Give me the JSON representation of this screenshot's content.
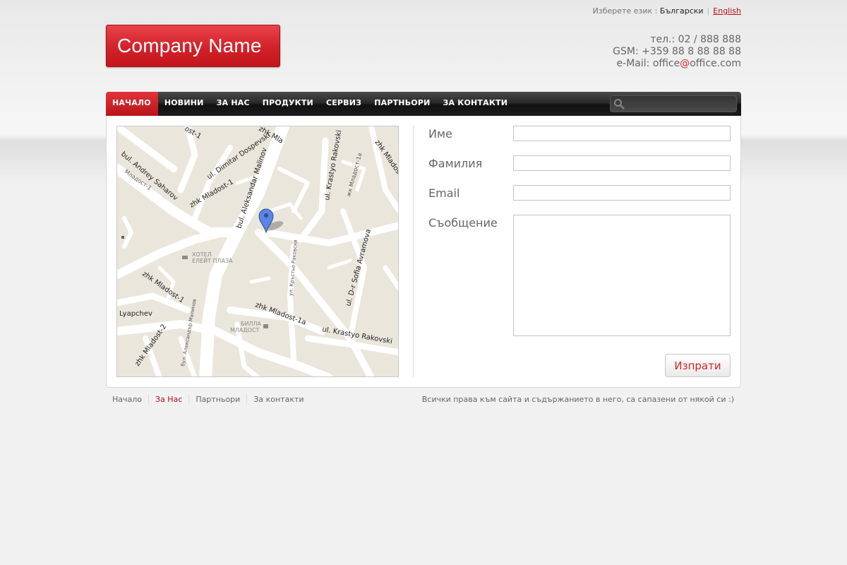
{
  "language": {
    "prompt": "Изберете език :",
    "current": "Български",
    "other": "English"
  },
  "logo": {
    "text": "Company Name"
  },
  "contacts": {
    "phone": "тел.: 02 / 888 888",
    "gsm": "GSM: +359 88 8 88 88 88",
    "email_prefix": "e-Mail: office",
    "email_at": "@",
    "email_suffix": "office.com"
  },
  "nav": {
    "items": [
      "НАЧАЛО",
      "НОВИНИ",
      "ЗА НАС",
      "ПРОДУКТИ",
      "СЕРВИЗ",
      "ПАРТНЬОРИ",
      "ЗА КОНТАКТИ"
    ],
    "active_index": 0
  },
  "map": {
    "labels": {
      "dimitar": "ul. Dimitar Dospevski",
      "sharov": "bul. Andrey Saharov",
      "mladost1a_top": "zhk Mladost-1",
      "malinov": "bul. Aleksandar Malinov",
      "rakovski": "ul. Krastyo Rakovski",
      "mladost_right": "zhk Mladost",
      "mladost1a": "жк Младост-1а",
      "hotel1": "ХОТЕЛ",
      "hotel2": "ЕЛЕЙТ ПЛАЗА",
      "rakovski_bg": "ул. Кръстьо Раковски",
      "sofia": "ul. D-r Sofia Avramova",
      "zhk_mladost1": "zhk Mladost-1",
      "zhk_mladost1a": "zhk Mladost-1a",
      "lyapchev": "Lyapchev",
      "billa1": "БИЛЛА",
      "billa2": "МЛАДОСТ",
      "rakovski2": "ul. Krastyo Rakovski",
      "mladost2": "zhk Mladost-2",
      "malinov_bg": "бул. Александър Малинов",
      "mladost1_bg": "Младост-1",
      "top_label": "ost-1",
      "top_label2": "zhk Mla"
    }
  },
  "form": {
    "first_name": "Име",
    "last_name": "Фамилия",
    "email": "Email",
    "message": "Съобщение",
    "submit": "Изпрати"
  },
  "footer": {
    "links": [
      "Начало",
      "За Нас",
      "Партньори",
      "За контакти"
    ],
    "active_index": 1,
    "copyright": "Всички права към сайта и съдържанието в него, са сапазени от някой си :)"
  },
  "colors": {
    "brand": "#d3242c",
    "nav_dark": "#1c1c1c",
    "map_bg": "#ebe6dc"
  }
}
